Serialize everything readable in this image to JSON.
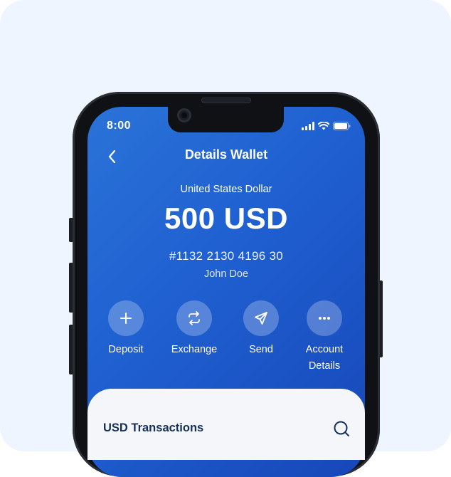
{
  "status_bar": {
    "time": "8:00"
  },
  "header": {
    "title": "Details Wallet"
  },
  "wallet": {
    "currency_name": "United States Dollar",
    "balance": "500 USD",
    "account_number": "#1132 2130 4196 30",
    "holder": "John Doe"
  },
  "actions": [
    {
      "label": "Deposit",
      "icon": "plus-icon"
    },
    {
      "label": "Exchange",
      "icon": "exchange-icon"
    },
    {
      "label": "Send",
      "icon": "send-icon"
    },
    {
      "label": "Account Details",
      "icon": "more-icon"
    }
  ],
  "transactions": {
    "title": "USD Transactions",
    "search_icon": "search-icon"
  },
  "colors": {
    "background": "#eef5fe",
    "primary_gradient_start": "#2a73d8",
    "primary_gradient_end": "#1747b8",
    "sheet": "#f4f6f9",
    "heading": "#153057"
  }
}
